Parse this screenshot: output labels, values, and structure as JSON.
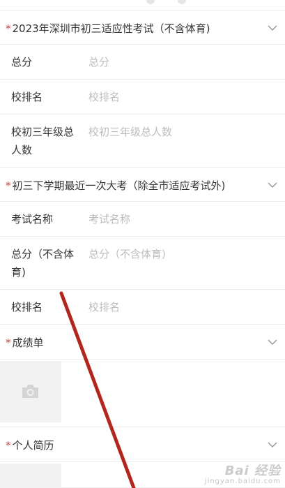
{
  "sections": [
    {
      "title": "2023年深圳市初三适应性考试（不含体育)",
      "required": "*",
      "rows": [
        {
          "label": "总分",
          "placeholder": "总分"
        },
        {
          "label": "校排名",
          "placeholder": "校排名"
        },
        {
          "label": "校初三年级总人数",
          "placeholder": "校初三年级总人数"
        }
      ]
    },
    {
      "title": "初三下学期最近一次大考（除全市适应考试外)",
      "required": "*",
      "rows": [
        {
          "label": "考试名称",
          "placeholder": "考试名称"
        },
        {
          "label": "总分（不含体育)",
          "placeholder": "总分（不含体育)"
        },
        {
          "label": "校排名",
          "placeholder": "校排名"
        }
      ]
    },
    {
      "title": "成绩单",
      "required": "*"
    },
    {
      "title": "个人简历",
      "required": "*"
    }
  ],
  "icons": {
    "chevron": "chevron-down-icon",
    "camera": "camera-icon"
  },
  "colors": {
    "required": "#d33b3b",
    "placeholder": "#bcbcbc",
    "annotation_line": "#b3261e"
  },
  "watermark": {
    "main": "Bai 经验",
    "sub": "jingyan.baidu.com"
  }
}
